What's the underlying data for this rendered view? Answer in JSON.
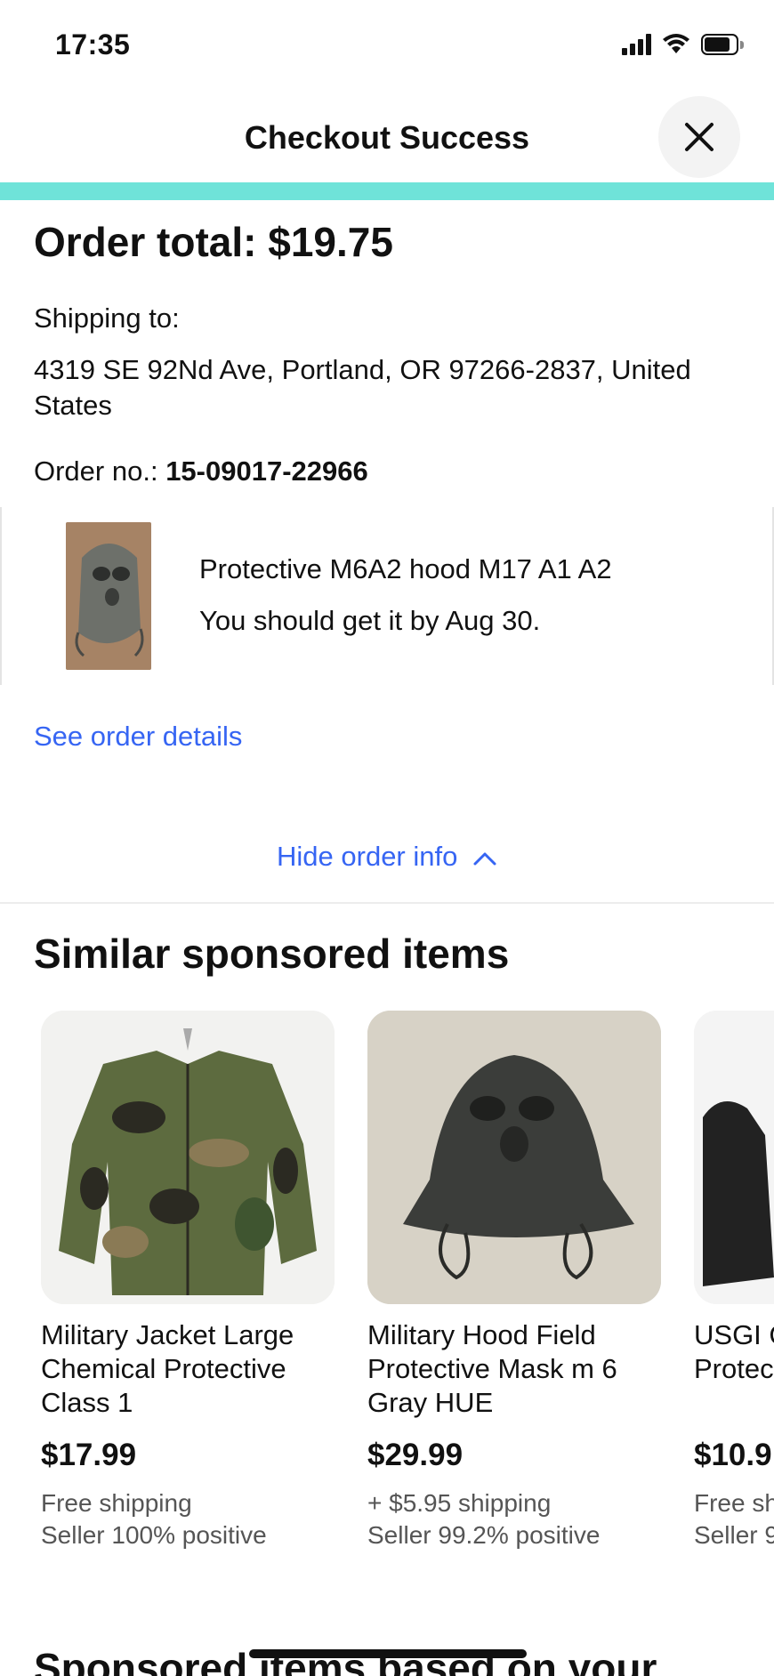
{
  "status_bar": {
    "time": "17:35"
  },
  "header": {
    "title": "Checkout Success"
  },
  "order": {
    "total": "Order total: $19.75",
    "shipping_label": "Shipping to:",
    "address": "4319 SE 92Nd Ave, Portland, OR 97266-2837, United States",
    "order_no_label": "Order no.:",
    "order_no": "15-09017-22966",
    "progress_percent": 100,
    "progress_color": "#6fe3d9"
  },
  "item": {
    "name": "Protective M6A2 hood M17 A1 A2",
    "eta": "You should get it by Aug 30."
  },
  "links": {
    "see_details": "See order details",
    "hide_info": "Hide order info",
    "link_color": "#3665f3"
  },
  "similar": {
    "title": "Similar sponsored items",
    "items": [
      {
        "title": "Military Jacket Large Chemical Protective Class 1",
        "price": "$17.99",
        "shipping": "Free shipping",
        "seller": "Seller 100% positive"
      },
      {
        "title": "Military Hood Field Protective Mask m 6 Gray HUE",
        "price": "$29.99",
        "shipping": "+ $5.95 shipping",
        "seller": "Seller 99.2% positive"
      },
      {
        "title": "USGI Chemical Protective Gloves",
        "price": "$10.9",
        "shipping": "Free sh",
        "seller": "Seller 9"
      }
    ]
  },
  "bottom": {
    "title": "Sponsored items based on your"
  }
}
